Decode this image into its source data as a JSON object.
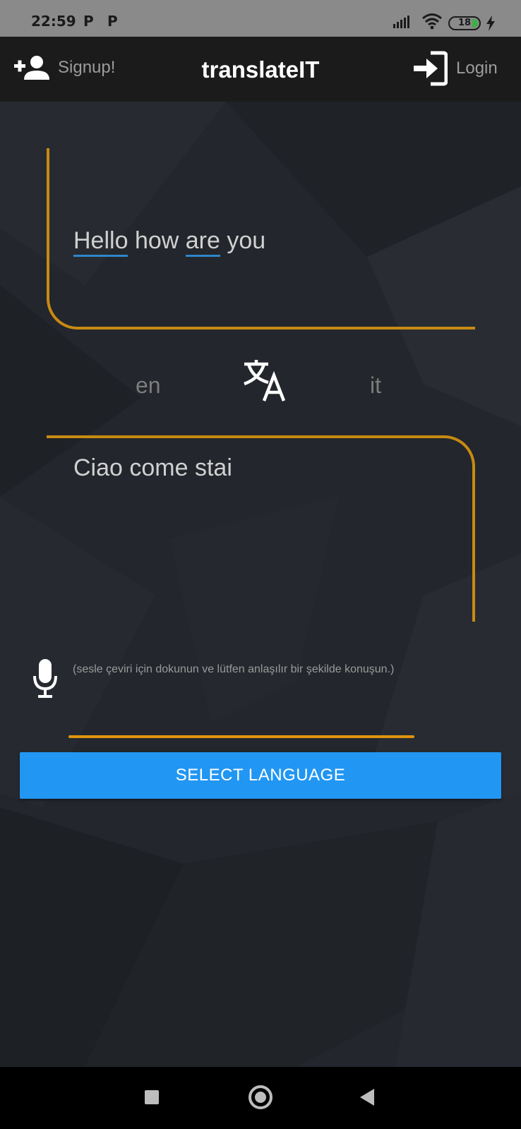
{
  "status_bar": {
    "time": "22:59",
    "notification_icons": [
      "P",
      "P"
    ],
    "battery": "18"
  },
  "app_bar": {
    "signup_label": "Signup!",
    "title": "translateIT",
    "login_label": "Login"
  },
  "translator": {
    "source_words": [
      "Hello",
      "how",
      "are",
      "you"
    ],
    "source_lang": "en",
    "target_lang": "it",
    "target_text": "Ciao come stai",
    "mic_hint": "(sesle çeviri için dokunun ve lütfen anlaşılır bir şekilde konuşun.)",
    "select_button": "SELECT LANGUAGE"
  },
  "colors": {
    "accent": "#c78a12",
    "button": "#2196f3",
    "spell_underline": "#2f86c9",
    "background": "#23262c"
  }
}
